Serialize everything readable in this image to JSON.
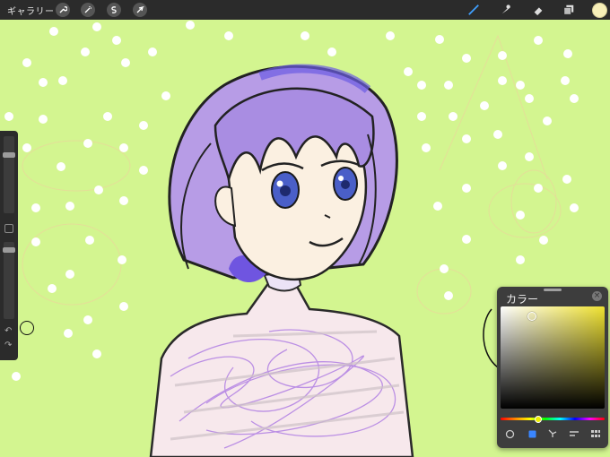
{
  "app": {
    "gallery_label": "ギャラリー",
    "tools_left": [
      "wrench-icon",
      "magic-wand-icon",
      "selection-icon",
      "transform-arrow-icon"
    ],
    "tools_right": [
      "brush-icon",
      "smudge-icon",
      "eraser-icon",
      "layers-icon",
      "color-swatch"
    ],
    "current_color": "#f7efb8"
  },
  "sidebar": {
    "controls": [
      "brush-size-slider",
      "modify-button",
      "opacity-slider",
      "undo-icon",
      "redo-icon"
    ]
  },
  "color_panel": {
    "title": "カラー",
    "close_label": "×",
    "mode_icons": [
      "disc-mode-icon",
      "classic-mode-icon",
      "harmony-mode-icon",
      "value-mode-icon",
      "palette-mode-icon"
    ],
    "selected_hue": "#efe130"
  },
  "canvas": {
    "background": "#d3f590",
    "hair_color": "#b79ce6",
    "skin_color": "#fbf0e1",
    "eye_color": "#4a5fc8"
  }
}
